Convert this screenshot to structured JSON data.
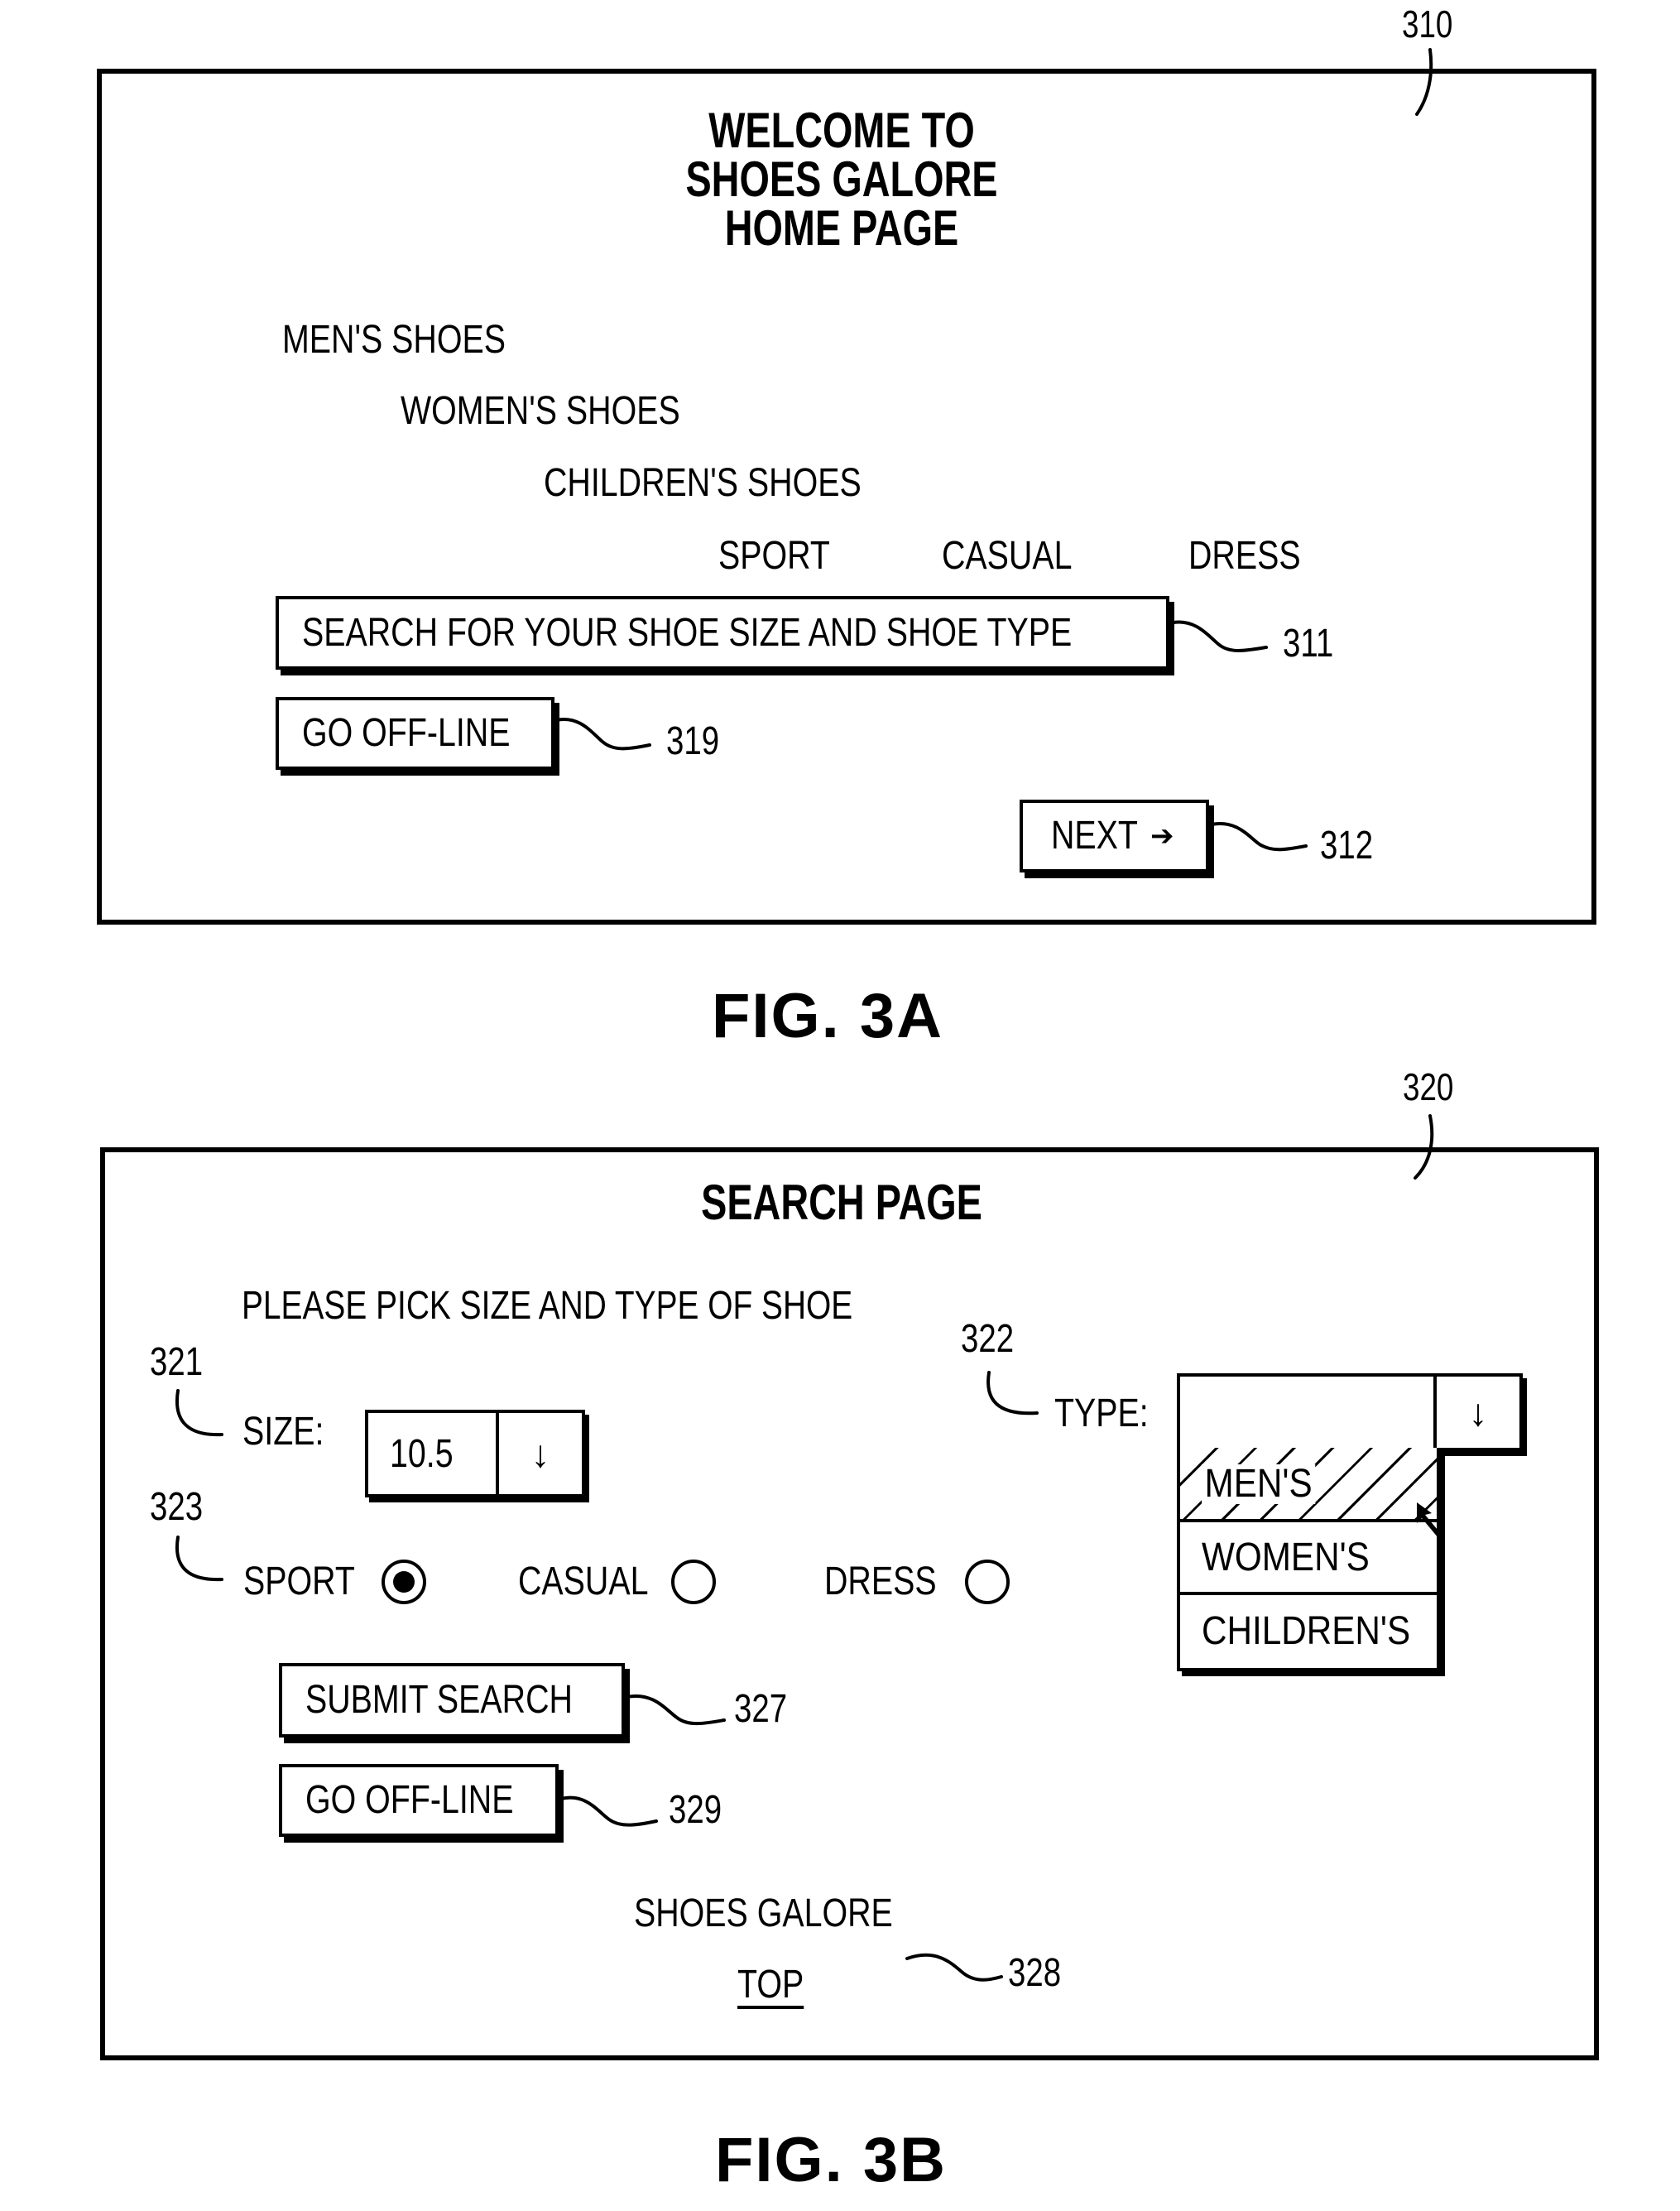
{
  "figures": {
    "fig3a": {
      "caption": "FIG.  3A",
      "ref_number": "310",
      "title_lines": [
        "WELCOME TO",
        "SHOES GALORE",
        "HOME PAGE"
      ],
      "categories": [
        "MEN'S SHOES",
        "WOMEN'S SHOES",
        "CHILDREN'S SHOES"
      ],
      "styles": [
        "SPORT",
        "CASUAL",
        "DRESS"
      ],
      "search_button": {
        "label": "SEARCH FOR YOUR SHOE SIZE AND SHOE TYPE",
        "ref": "311"
      },
      "offline_button": {
        "label": "GO OFF-LINE",
        "ref": "319"
      },
      "next_button": {
        "label": "NEXT",
        "icon": "right-arrow-icon",
        "arrow_glyph": "➔",
        "ref": "312"
      }
    },
    "fig3b": {
      "caption": "FIG.  3B",
      "ref_number": "320",
      "title": "SEARCH PAGE",
      "instruction": "PLEASE PICK SIZE AND TYPE OF SHOE",
      "size": {
        "label": "SIZE:",
        "value": "10.5",
        "ref": "321",
        "arrow_glyph": "↓",
        "icon": "down-arrow-icon"
      },
      "type": {
        "label": "TYPE:",
        "value": "",
        "ref": "322",
        "arrow_glyph": "↓",
        "icon": "down-arrow-icon",
        "options": [
          "MEN'S",
          "WOMEN'S",
          "CHILDREN'S"
        ],
        "highlighted_option": "MEN'S"
      },
      "style_radios": {
        "ref": "323",
        "options": [
          {
            "label": "SPORT",
            "selected": true
          },
          {
            "label": "CASUAL",
            "selected": false
          },
          {
            "label": "DRESS",
            "selected": false
          }
        ]
      },
      "submit_button": {
        "label": "SUBMIT SEARCH",
        "ref": "327"
      },
      "offline_button": {
        "label": "GO OFF-LINE",
        "ref": "329"
      },
      "footer": {
        "site_name": "SHOES GALORE",
        "top_link": "TOP",
        "ref": "328"
      }
    }
  }
}
